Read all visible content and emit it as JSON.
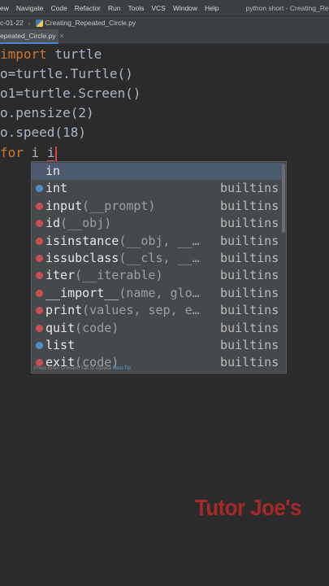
{
  "menu": {
    "items": [
      "ew",
      "Navigate",
      "Code",
      "Refactor",
      "Run",
      "Tools",
      "VCS",
      "Window",
      "Help"
    ],
    "window_title": "python short - Creating_Repeated_Circle.py"
  },
  "breadcrumb": {
    "folder": "c-01-22",
    "file": "Creating_Repeated_Circle.py"
  },
  "tab": {
    "label": "epeated_Circle.py",
    "close": "×"
  },
  "code": [
    {
      "kw": "import",
      "rest": " turtle"
    },
    {
      "kw": "",
      "rest": "o=turtle.Turtle()"
    },
    {
      "kw": "",
      "rest": "o1=turtle.Screen()"
    },
    {
      "kw": "",
      "rest": "o.pensize(2)"
    },
    {
      "kw": "",
      "rest": "o.speed(18)"
    },
    {
      "kw": "for",
      "rest": " i ",
      "typed": "i"
    }
  ],
  "autocomplete": {
    "items": [
      {
        "name": "in",
        "args": "",
        "source": "",
        "icon": "none"
      },
      {
        "name": "int",
        "args": "",
        "source": "builtins",
        "icon": "c"
      },
      {
        "name": "input",
        "args": "(__prompt)",
        "source": "builtins",
        "icon": "f"
      },
      {
        "name": "id",
        "args": "(__obj)",
        "source": "builtins",
        "icon": "f"
      },
      {
        "name": "isinstance",
        "args": "(__obj, __…",
        "source": "builtins",
        "icon": "f"
      },
      {
        "name": "issubclass",
        "args": "(__cls, __…",
        "source": "builtins",
        "icon": "f"
      },
      {
        "name": "iter",
        "args": "(__iterable)",
        "source": "builtins",
        "icon": "f"
      },
      {
        "name": "__import__",
        "args": "(name, glo…",
        "source": "builtins",
        "icon": "f"
      },
      {
        "name": "print",
        "args": "(values, sep, e…",
        "source": "builtins",
        "icon": "f"
      },
      {
        "name": "quit",
        "args": "(code)",
        "source": "builtins",
        "icon": "f"
      },
      {
        "name": "list",
        "args": "",
        "source": "builtins",
        "icon": "c"
      },
      {
        "name": "exit",
        "args": "(code)",
        "source": "builtins",
        "icon": "f"
      }
    ],
    "hint": "Press Enter to insert, Tab to replace",
    "hint_link": "Next Tip"
  },
  "watermark": "Tutor Joe's",
  "colors": {
    "keyword": "#cc7832",
    "text": "#a9b7c6",
    "background": "#2b2b2b",
    "accent": "#4a88c7",
    "watermark": "#a82828"
  }
}
